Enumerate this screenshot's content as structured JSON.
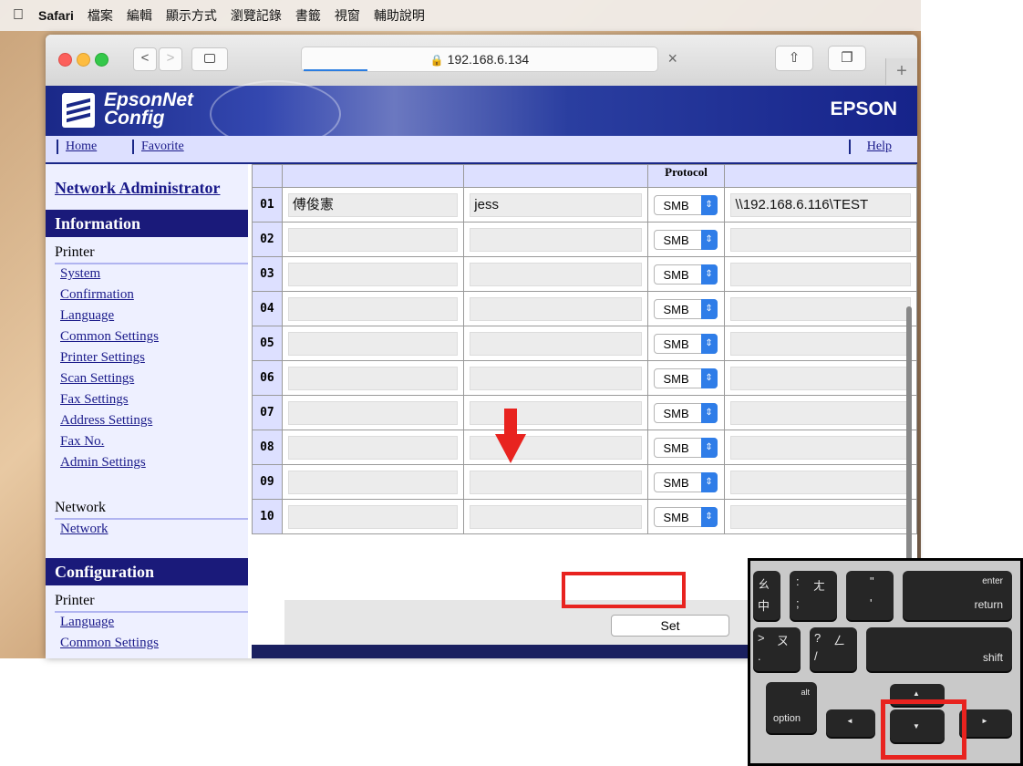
{
  "menubar": {
    "items": [
      "Safari",
      "檔案",
      "編輯",
      "顯示方式",
      "瀏覽記錄",
      "書籤",
      "視窗",
      "輔助說明"
    ]
  },
  "browser": {
    "url": "192.168.6.134",
    "lock_icon": "lock-icon",
    "back_label": "<",
    "forward_label": ">",
    "close_label": "×",
    "new_tab_label": "+"
  },
  "banner": {
    "brand_line1": "EpsonNet",
    "brand_line2": "Config",
    "epson": "EPSON"
  },
  "nav": {
    "home": "Home",
    "favorite": "Favorite",
    "help": "Help"
  },
  "sidebar": {
    "admin": "Network Administrator",
    "info_head": "Information",
    "printer_label": "Printer",
    "info_links": [
      "System",
      "Confirmation",
      "Language",
      "Common Settings",
      "Printer Settings",
      "Scan Settings",
      "Fax Settings",
      "Address Settings",
      "Fax No.",
      "Admin Settings"
    ],
    "network_label": "Network",
    "network_link": "Network",
    "config_head": "Configuration",
    "config_printer_label": "Printer",
    "config_links": [
      "Language",
      "Common Settings"
    ]
  },
  "table": {
    "protocol_header": "Protocol",
    "rows": [
      {
        "num": "01",
        "name": "傅俊憲",
        "user": "jess",
        "protocol": "SMB",
        "path": "\\\\192.168.6.116\\TEST"
      },
      {
        "num": "02",
        "name": "",
        "user": "",
        "protocol": "SMB",
        "path": ""
      },
      {
        "num": "03",
        "name": "",
        "user": "",
        "protocol": "SMB",
        "path": ""
      },
      {
        "num": "04",
        "name": "",
        "user": "",
        "protocol": "SMB",
        "path": ""
      },
      {
        "num": "05",
        "name": "",
        "user": "",
        "protocol": "SMB",
        "path": ""
      },
      {
        "num": "06",
        "name": "",
        "user": "",
        "protocol": "SMB",
        "path": ""
      },
      {
        "num": "07",
        "name": "",
        "user": "",
        "protocol": "SMB",
        "path": ""
      },
      {
        "num": "08",
        "name": "",
        "user": "",
        "protocol": "SMB",
        "path": ""
      },
      {
        "num": "09",
        "name": "",
        "user": "",
        "protocol": "SMB",
        "path": ""
      },
      {
        "num": "10",
        "name": "",
        "user": "",
        "protocol": "SMB",
        "path": ""
      }
    ]
  },
  "set_button": "Set",
  "keyboard": {
    "enter": "enter",
    "return": "return",
    "shift": "shift",
    "alt": "alt",
    "option": "option",
    "key_zhuyin_1a": "ㄠ",
    "key_zhuyin_1b": "中",
    "key_zhuyin_2a": ":",
    "key_zhuyin_2b": "ㄤ",
    "key_zhuyin_2c": ";",
    "key_quote_top": "\"",
    "key_quote_bottom": "'",
    "key_gt": ">",
    "key_zhuyin_3": "ㄡ",
    "key_dot": ".",
    "key_q": "?",
    "key_zhuyin_4": "ㄥ",
    "key_slash": "/",
    "arrow_up": "▲",
    "arrow_down": "▼",
    "arrow_left": "◄",
    "arrow_right": "►"
  },
  "colors": {
    "banner": "#1a2888",
    "nav_bg": "#dde0ff",
    "highlight": "#e8231f",
    "select_accent": "#2f7de8"
  }
}
